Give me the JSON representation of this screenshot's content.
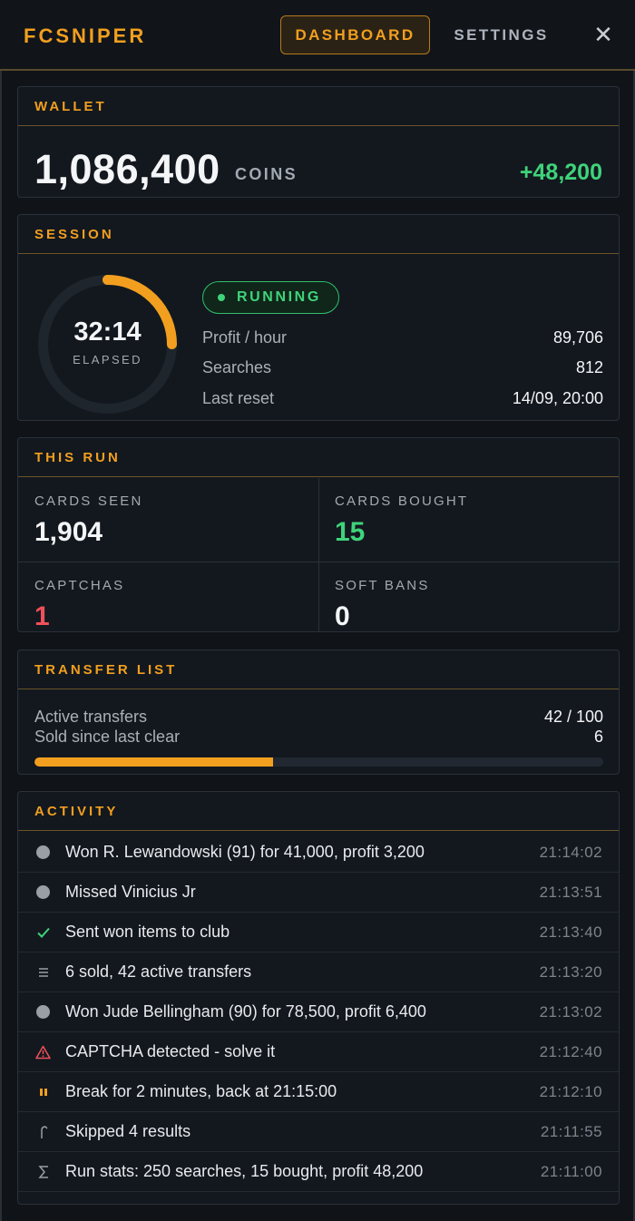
{
  "app": {
    "brand": "FCSNIPER"
  },
  "nav": {
    "dashboard": "DASHBOARD",
    "settings": "SETTINGS",
    "close": "✕"
  },
  "wallet": {
    "title": "WALLET",
    "amount": "1,086,400",
    "unit": "COINS",
    "delta": "+48,200"
  },
  "session": {
    "title": "SESSION",
    "elapsed": "32:14",
    "elapsed_label": "ELAPSED",
    "ring_progress": 0.25,
    "status": "RUNNING",
    "rows": [
      {
        "key": "Profit / hour",
        "value": "89,706"
      },
      {
        "key": "Searches",
        "value": "812"
      },
      {
        "key": "Last reset",
        "value": "14/09, 20:00"
      }
    ]
  },
  "run": {
    "title": "THIS RUN",
    "cards_seen": {
      "label": "CARDS SEEN",
      "value": "1,904"
    },
    "cards_bought": {
      "label": "CARDS BOUGHT",
      "value": "15"
    },
    "captchas": {
      "label": "CAPTCHAS",
      "value": "1"
    },
    "soft_bans": {
      "label": "SOFT BANS",
      "value": "0"
    }
  },
  "transfer": {
    "title": "TRANSFER LIST",
    "active_label": "Active transfers",
    "active_value": "42 / 100",
    "active_fraction": 0.42,
    "sold_label": "Sold since last clear",
    "sold_value": "6"
  },
  "activity": {
    "title": "ACTIVITY",
    "items": [
      {
        "icon": "dot-icon",
        "text": "Won R. Lewandowski (91) for 41,000, profit 3,200",
        "time": "21:14:02"
      },
      {
        "icon": "dot-icon",
        "text": "Missed Vinicius Jr",
        "time": "21:13:51"
      },
      {
        "icon": "check-icon",
        "text": "Sent won items to club",
        "time": "21:13:40"
      },
      {
        "icon": "list-icon",
        "text": "6 sold, 42 active transfers",
        "time": "21:13:20"
      },
      {
        "icon": "dot-icon",
        "text": "Won Jude Bellingham (90) for 78,500, profit 6,400",
        "time": "21:13:02"
      },
      {
        "icon": "warning-icon",
        "text": "CAPTCHA detected - solve it",
        "time": "21:12:40"
      },
      {
        "icon": "pause-icon",
        "text": "Break for 2 minutes, back at 21:15:00",
        "time": "21:12:10"
      },
      {
        "icon": "skip-icon",
        "text": "Skipped 4 results",
        "time": "21:11:55"
      },
      {
        "icon": "sigma-icon",
        "text": "Run stats: 250 searches, 15 bought, profit 48,200",
        "time": "21:11:00"
      }
    ]
  },
  "colors": {
    "accent": "#f29f1f",
    "success": "#3fd37a",
    "danger": "#f0505a",
    "muted": "#a3a9b2"
  }
}
